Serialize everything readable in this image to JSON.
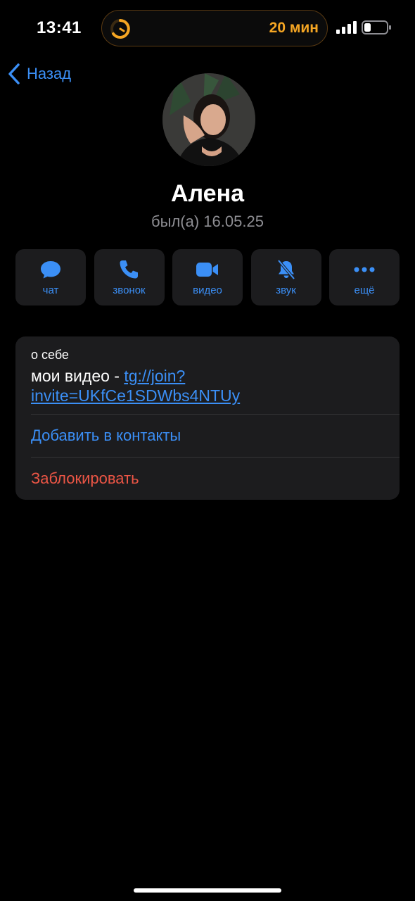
{
  "status_bar": {
    "time": "13:41",
    "island_label": "20 мин",
    "accent_color": "#f5a623"
  },
  "nav": {
    "back_label": "Назад"
  },
  "profile": {
    "name": "Алена",
    "last_seen": "был(а) 16.05.25"
  },
  "actions": [
    {
      "label": "чат",
      "icon": "chat-bubble-icon"
    },
    {
      "label": "звонок",
      "icon": "phone-icon"
    },
    {
      "label": "видео",
      "icon": "video-camera-icon"
    },
    {
      "label": "звук",
      "icon": "bell-muted-icon"
    },
    {
      "label": "ещё",
      "icon": "more-dots-icon"
    }
  ],
  "about": {
    "label": "о себе",
    "text_prefix": "мои видео - ",
    "link_line1": "tg://join?",
    "link_line2": "invite=UKfCe1SDWbs4NTUy"
  },
  "rows": {
    "add_contact": "Добавить в контакты",
    "block": "Заблокировать"
  },
  "colors": {
    "background": "#000000",
    "card": "#1c1c1e",
    "accent_blue": "#3b8ff6",
    "destructive_red": "#eb5545",
    "secondary_text": "#8e8e93"
  }
}
